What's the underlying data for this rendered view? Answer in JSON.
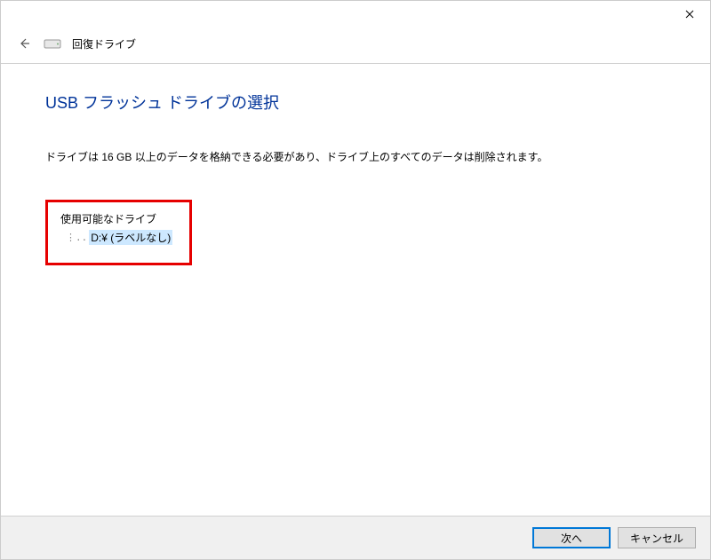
{
  "header": {
    "title": "回復ドライブ"
  },
  "main": {
    "page_title": "USB フラッシュ ドライブの選択",
    "description": "ドライブは 16 GB 以上のデータを格納できる必要があり、ドライブ上のすべてのデータは削除されます。",
    "drives_label": "使用可能なドライブ",
    "drives": [
      {
        "label": "D:¥ (ラベルなし)"
      }
    ]
  },
  "footer": {
    "next_label": "次へ",
    "cancel_label": "キャンセル"
  }
}
